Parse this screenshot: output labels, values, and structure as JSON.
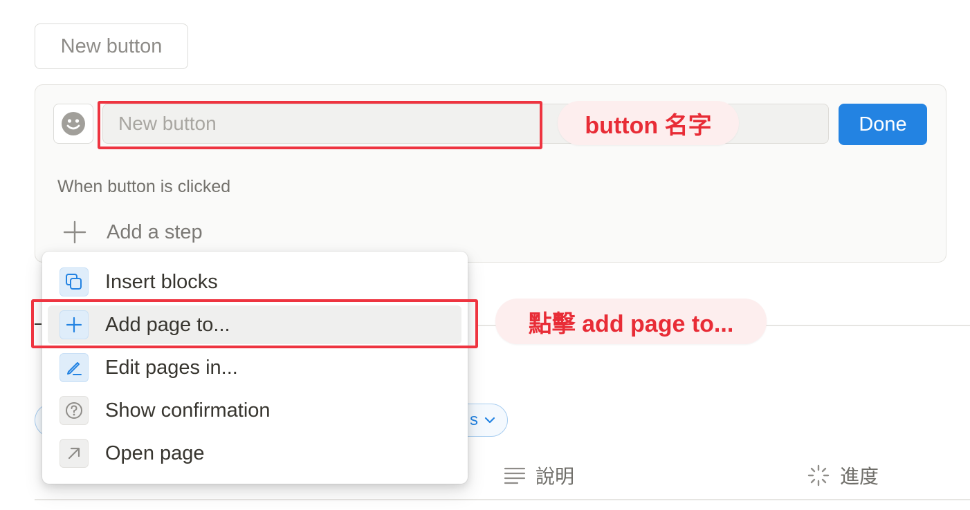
{
  "top_button": {
    "label": "New button"
  },
  "editor": {
    "emoji_icon": "smiley-face-icon",
    "name_placeholder": "New button",
    "done_label": "Done",
    "when_label": "When button is clicked",
    "add_step_label": "Add a step"
  },
  "menu": {
    "items": [
      {
        "label": "Insert blocks",
        "icon": "copy-blocks-icon",
        "active": false
      },
      {
        "label": "Add page to...",
        "icon": "plus-icon",
        "active": true
      },
      {
        "label": "Edit pages in...",
        "icon": "pencil-icon",
        "active": false
      },
      {
        "label": "Show confirmation",
        "icon": "question-circle-icon",
        "active": false
      },
      {
        "label": "Open page",
        "icon": "arrow-up-right-icon",
        "active": false
      }
    ]
  },
  "background": {
    "pill_text": "s",
    "columns": [
      {
        "label": "說明",
        "icon": "text-lines-icon"
      },
      {
        "label": "進度",
        "icon": "loading-spinner-icon"
      }
    ]
  },
  "annotations": {
    "callout_name": "button 名字",
    "callout_click": "點擊 add page to..."
  },
  "colors": {
    "accent_blue": "#2383e2",
    "annotation_red": "#ee3440",
    "callout_bg": "#fdeeee"
  }
}
